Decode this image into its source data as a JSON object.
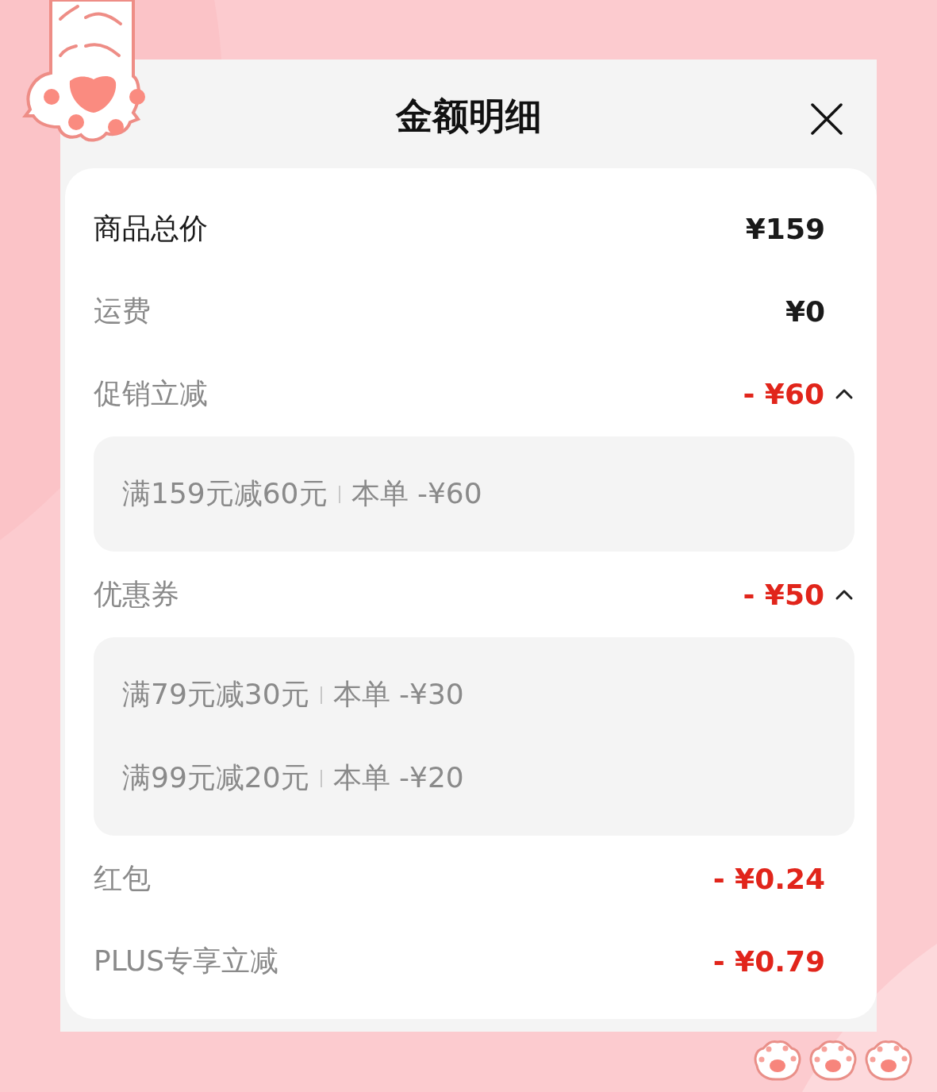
{
  "title": "金额明细",
  "rows": [
    {
      "kind": "total",
      "label": "商品总价",
      "amount": "¥159"
    },
    {
      "kind": "item",
      "label": "运费",
      "amount": "¥0"
    },
    {
      "kind": "discount",
      "label": "促销立减",
      "amount": "- ¥60",
      "expanded": true,
      "details": [
        {
          "condition": "满159元减60元",
          "deduction": "本单 -¥60"
        }
      ]
    },
    {
      "kind": "discount",
      "label": "优惠券",
      "amount": "- ¥50",
      "expanded": true,
      "details": [
        {
          "condition": "满79元减30元",
          "deduction": "本单 -¥30"
        },
        {
          "condition": "满99元减20元",
          "deduction": "本单 -¥20"
        }
      ]
    },
    {
      "kind": "discount",
      "label": "红包",
      "amount": "- ¥0.24"
    },
    {
      "kind": "discount",
      "label": "PLUS专享立减",
      "amount": "- ¥0.79"
    }
  ]
}
